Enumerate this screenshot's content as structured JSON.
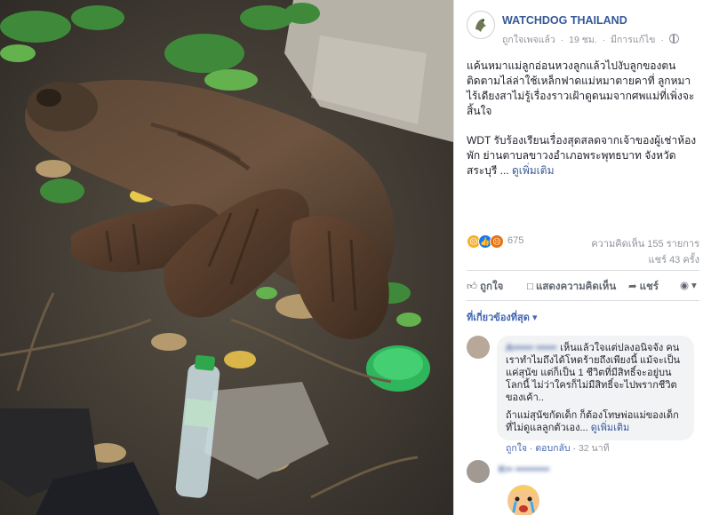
{
  "post": {
    "page_name": "WATCHDOG THAILAND",
    "meta_liked": "ถูกใจเพจแล้ว",
    "meta_time": "19 ชม.",
    "meta_edited": "มีการแก้ไข",
    "paragraph_1": "แค้นหมาแม่ลูกอ่อนหวงลูกแล้วไปงับลูกของตน ติดตามไล่ล่าใช้เหล็กฟาดแม่หมาตายคาที่ ลูกหมาไร้เดียงสาไม่รู้เรื่องราวเฝ้าดูดนมจากศพแม่ที่เพิ่งจะสิ้นใจ",
    "paragraph_2": "WDT รับร้องเรียนเรื่องสุดสลดจากเจ้าของผู้เช่าห้องพัก ย่านตาบลขาวงอำเภอพระพุทธบาท จังหวัดสระบุรี ...",
    "see_more": "ดูเพิ่มเติม"
  },
  "stats": {
    "reaction_count": "675",
    "comments": "ความคิดเห็น 155 รายการ",
    "shares": "แชร์ 43 ครั้ง"
  },
  "actions": {
    "like": "ถูกใจ",
    "comment": "แสดงความคิดเห็น",
    "share": "แชร์"
  },
  "comments_filter": "ที่เกี่ยวข้องที่สุด",
  "comments": [
    {
      "author": "A•••••• ••••••",
      "text_1": "เห็นแล้วใจแต่ปลงอนิจจัง คนเราทำไมถึงได้โหดร้ายถึงเพียงนี้ แม้จะเป็นแค่สุนัข แต่ก็เป็น 1 ชีวิตที่มีสิทธิ์จะอยู่บนโลกนี้ ไม่ว่าใครก็ไม่มีสิทธิ์จะไปพรากชีวิตของเค้า..",
      "text_2": "ถ้าแม่สุนัขกัดเด็ก ก็ต้องโทษพ่อแม่ของเด็กที่ไม่ดูแลลูกตัวเอง...",
      "see_more": "ดูเพิ่มเติม",
      "like": "ถูกใจ",
      "reply": "ตอบกลับ",
      "time": "32 นาที"
    },
    {
      "author": "K•• ••••••••••"
    }
  ],
  "colors": {
    "link": "#385898",
    "accent": "#4267b2",
    "muted": "#90949c",
    "bubble": "#f2f3f5"
  }
}
